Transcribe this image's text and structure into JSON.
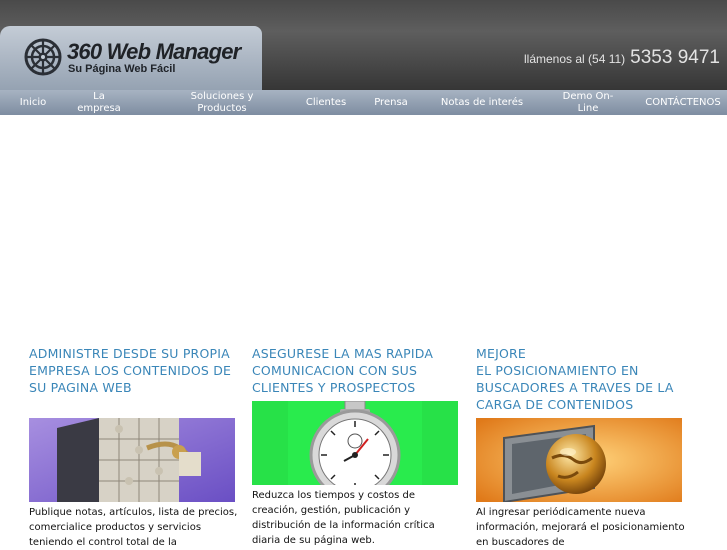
{
  "brand": {
    "title": "360 Web Manager",
    "tagline": "Su Página Web Fácil"
  },
  "contact": {
    "prefix": "llámenos al (54 11)",
    "number": "5353 9471"
  },
  "nav": [
    {
      "label": "Inicio"
    },
    {
      "label": "La empresa"
    },
    {
      "label": "Soluciones y Productos"
    },
    {
      "label": "Clientes"
    },
    {
      "label": "Prensa"
    },
    {
      "label": "Notas de interés"
    },
    {
      "label": "Demo On-Line"
    },
    {
      "label": "CONTÁCTENOS"
    }
  ],
  "features": [
    {
      "heading": "ADMINISTRE DESDE SU PROPIA EMPRESA LOS CONTENIDOS DE SU PAGINA WEB",
      "text": "Publique notas, artículos, lista de precios,  comercialice productos y servicios teniendo el control total de la"
    },
    {
      "heading": "ASEGURESE LA MAS RAPIDA COMUNICACION CON SUS CLIENTES Y PROSPECTOS",
      "text": "Reduzca los tiempos y costos de creación, gestión, publicación y distribución de la información crítica diaria de su página web."
    },
    {
      "heading": "MEJORE\nEL POSICIONAMIENTO EN BUSCADORES A TRAVES DE LA CARGA DE CONTENIDOS",
      "text": "Al ingresar periódicamente nueva información, mejorará el posicionamiento en buscadores de"
    }
  ],
  "colors": {
    "heading": "#3a86b8",
    "nav_bar": "#8d9bad",
    "header_dark": "#3c3c3c"
  }
}
